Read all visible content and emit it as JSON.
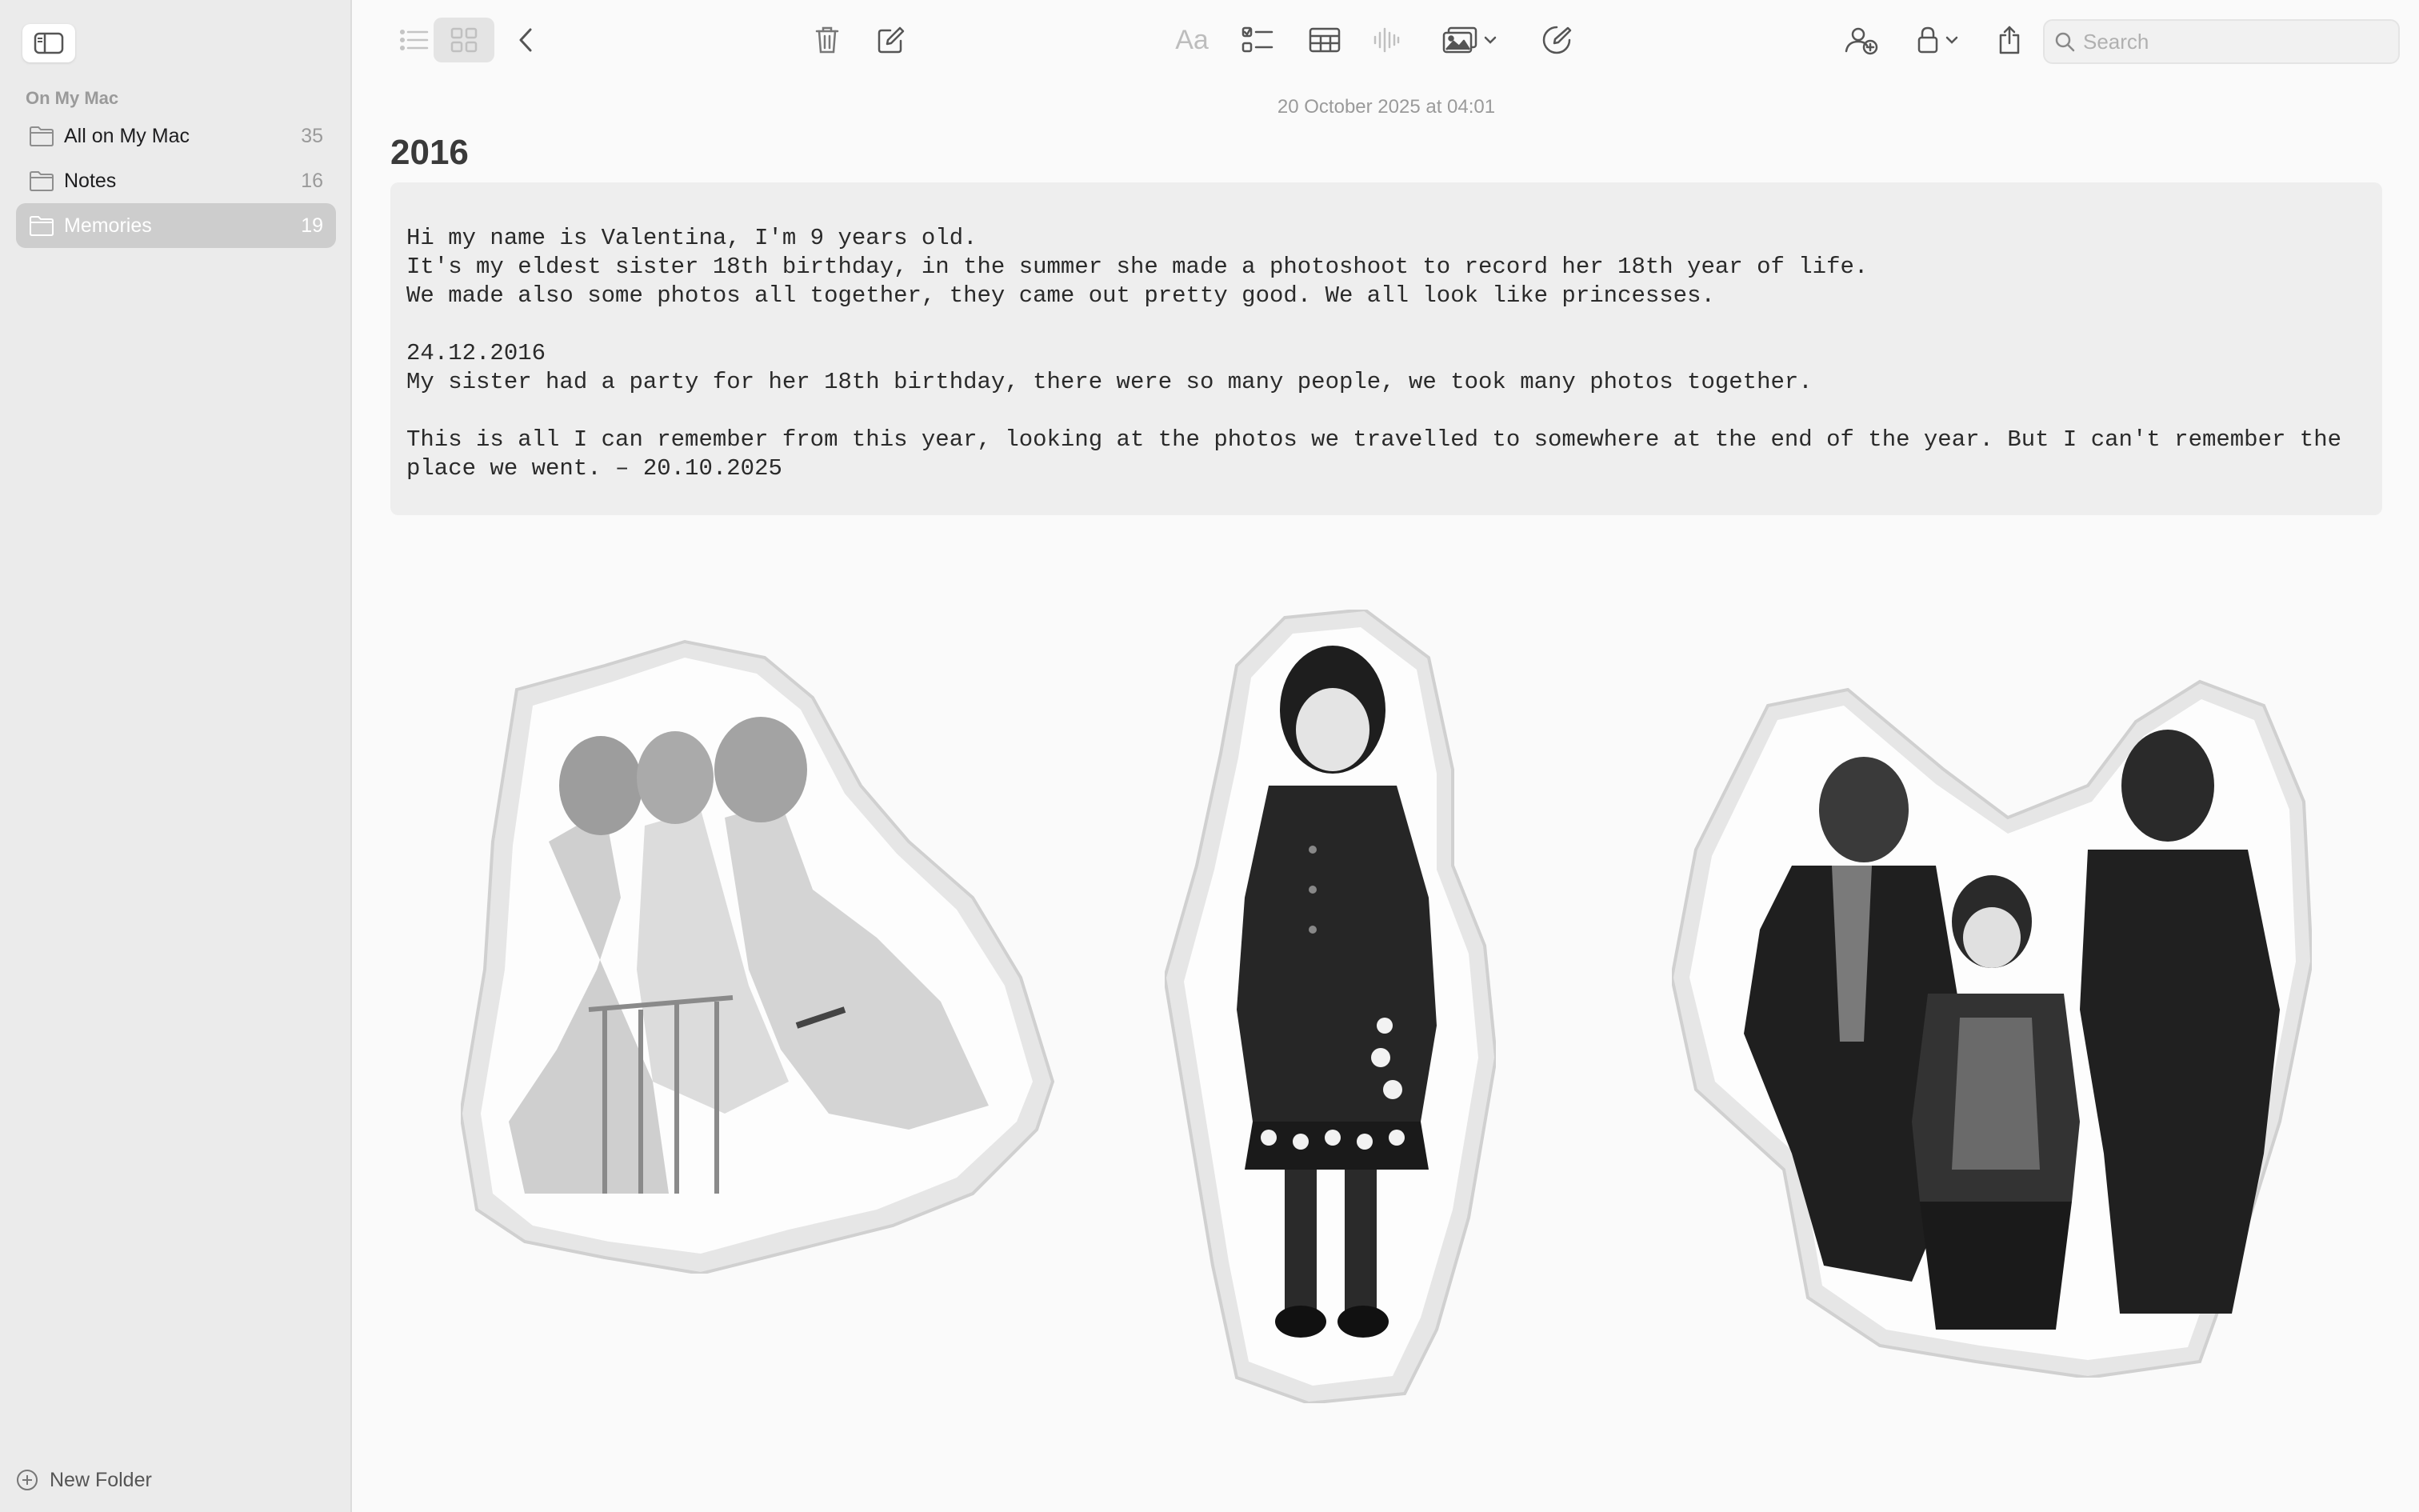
{
  "sidebar": {
    "section_title": "On My Mac",
    "folders": [
      {
        "name": "All on My Mac",
        "count": "35",
        "selected": false
      },
      {
        "name": "Notes",
        "count": "16",
        "selected": false
      },
      {
        "name": "Memories",
        "count": "19",
        "selected": true
      }
    ],
    "new_folder_label": "New Folder"
  },
  "toolbar": {
    "format_label": "Aa",
    "search_placeholder": "Search"
  },
  "note": {
    "date": "20 October 2025 at 04:01",
    "title": "2016",
    "body": "Hi my name is Valentina, I'm 9 years old.\nIt's my eldest sister 18th birthday, in the summer she made a photoshoot to record her 18th year of life.\nWe made also some photos all together, they came out pretty good. We all look like princesses.\n\n24.12.2016\nMy sister had a party for her 18th birthday, there were so many people, we took many photos together.\n\nThis is all I can remember from this year, looking at the photos we travelled to somewhere at the end of the year. But I can't remember the place we went. – 20.10.2025"
  },
  "photos": [
    {
      "icon": "three-girls-in-dresses-photo"
    },
    {
      "icon": "girl-in-black-coat-photo"
    },
    {
      "icon": "family-in-winter-coats-photo"
    }
  ],
  "colors": {
    "sidebar_bg": "#ebebeb",
    "selected_folder_bg": "#cdcdcd",
    "code_block_bg": "#eeeeee",
    "canvas_bg": "#fafafa"
  }
}
